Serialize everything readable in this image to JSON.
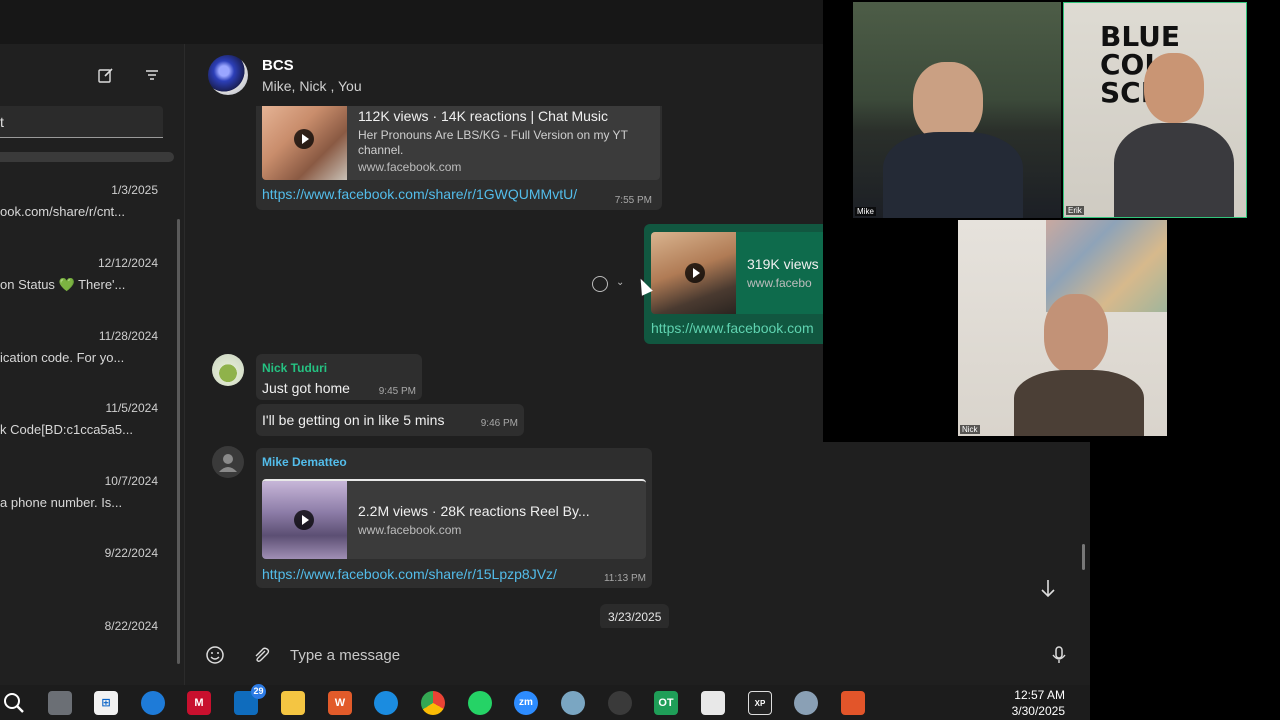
{
  "sidebar": {
    "search_value": "t",
    "chats": [
      {
        "date": "1/3/2025",
        "preview": "ook.com/share/r/cnt..."
      },
      {
        "date": "12/12/2024",
        "preview": "on Status 💚 There'..."
      },
      {
        "date": "11/28/2024",
        "preview": "ication code. For yo..."
      },
      {
        "date": "11/5/2024",
        "preview": "k Code[BD:c1cca5a5..."
      },
      {
        "date": "10/7/2024",
        "preview": "a phone number. Is..."
      },
      {
        "date": "9/22/2024",
        "preview": ""
      },
      {
        "date": "8/22/2024",
        "preview": ""
      }
    ]
  },
  "chat": {
    "name": "BCS",
    "members": "Mike, Nick , You"
  },
  "messages": {
    "m1": {
      "card_title": "112K views · 14K reactions | Chat Music",
      "card_desc": "Her Pronouns Are LBS/KG - Full Version on my YT channel.",
      "card_domain": "www.facebook.com",
      "url": "https://www.facebook.com/share/r/1GWQUMMvtU/",
      "time": "7:55 PM"
    },
    "m2": {
      "card_title": "319K views",
      "card_domain": "www.facebo",
      "url": "https://www.facebook.com"
    },
    "m3": {
      "sender": "Nick Tuduri",
      "sender_color": "#25c282",
      "text": "Just got home",
      "time": "9:45 PM"
    },
    "m4": {
      "text": "I'll be getting on in like 5 mins",
      "time": "9:46 PM"
    },
    "m5": {
      "sender": "Mike Dematteo",
      "sender_color": "#53bdeb",
      "card_title": "2.2M views · 28K reactions Reel By...",
      "card_domain": "www.facebook.com",
      "url": "https://www.facebook.com/share/r/15Lpzp8JVz/",
      "time": "11:13 PM"
    }
  },
  "date_chip": "3/23/2025",
  "composer": {
    "placeholder": "Type a message"
  },
  "video": {
    "tile1_label": "Mike",
    "tile2_label": "Erik",
    "tile3_label": "Nick"
  },
  "taskbar": {
    "badge_count": "29",
    "time": "12:57 AM",
    "date": "3/30/2025"
  }
}
